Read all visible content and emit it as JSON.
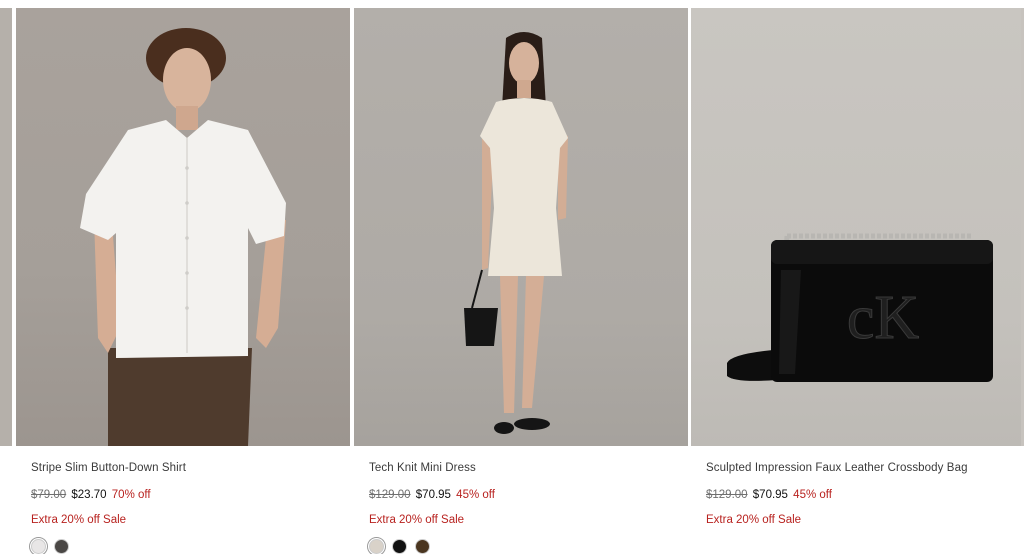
{
  "products": [
    {
      "name": "Stripe Slim Button-Down Shirt",
      "old_price": "$79.00",
      "price": "$23.70",
      "discount": "70% off",
      "promo": "Extra 20% off Sale",
      "swatch_colors": [
        "#e8e6e6",
        "#4a4745"
      ]
    },
    {
      "name": "Tech Knit Mini Dress",
      "old_price": "$129.00",
      "price": "$70.95",
      "discount": "45% off",
      "promo": "Extra 20% off Sale",
      "swatch_colors": [
        "#d9d2c9",
        "#111111",
        "#4a3520"
      ]
    },
    {
      "name": "Sculpted Impression Faux Leather Crossbody Bag",
      "old_price": "$129.00",
      "price": "$70.95",
      "discount": "45% off",
      "promo": "Extra 20% off Sale",
      "swatch_colors": []
    }
  ],
  "colors": {
    "sale_red": "#b8221f",
    "text": "#3a3a3a"
  }
}
